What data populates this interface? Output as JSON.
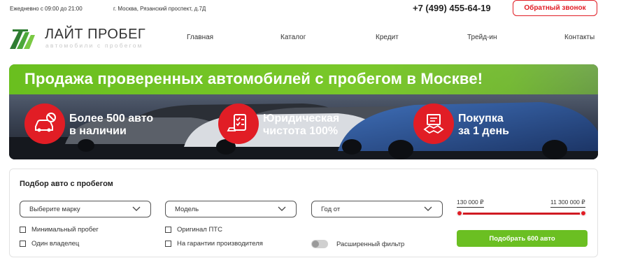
{
  "topbar": {
    "hours": "Ежедневно с 09:00 до 21:00",
    "address": "г. Москва, Рязанский проспект, д.7Д",
    "phone": "+7 (499) 455-64-19",
    "callback_label": "Обратный звонок"
  },
  "logo": {
    "title": "ЛАЙТ ПРОБЕГ",
    "subtitle": "автомобили с пробегом"
  },
  "nav": {
    "items": [
      {
        "label": "Главная"
      },
      {
        "label": "Каталог"
      },
      {
        "label": "Кредит"
      },
      {
        "label": "Трейд-ин"
      },
      {
        "label": "Контакты"
      }
    ]
  },
  "banner": {
    "title": "Продажа проверенных автомобилей с пробегом в Москве!",
    "features": [
      {
        "line1": "Более 500 авто",
        "line2": "в наличии",
        "icon": "car-icon"
      },
      {
        "line1": "Юридическая",
        "line2": "чистота 100%",
        "icon": "checklist-icon"
      },
      {
        "line1": "Покупка",
        "line2": "за 1 день",
        "icon": "handshake-icon"
      }
    ]
  },
  "filter": {
    "title": "Подбор авто с пробегом",
    "selects": [
      {
        "value": "Выберите марку"
      },
      {
        "value": "Модель"
      },
      {
        "value": "Год от"
      }
    ],
    "checkboxes": [
      {
        "label": "Минимальный пробег",
        "checked": false
      },
      {
        "label": "Один владелец",
        "checked": false
      },
      {
        "label": "Оригинал ПТС",
        "checked": false
      },
      {
        "label": "На гарантии производителя",
        "checked": false
      }
    ],
    "extended_toggle": {
      "label": "Расширенный фильтр",
      "on": false
    },
    "price_min": "130 000 ₽",
    "price_max": "11 300 000 ₽",
    "submit_label": "Подобрать 600 авто"
  },
  "colors": {
    "accent_red": "#e11d25",
    "accent_green": "#6bbf22"
  }
}
